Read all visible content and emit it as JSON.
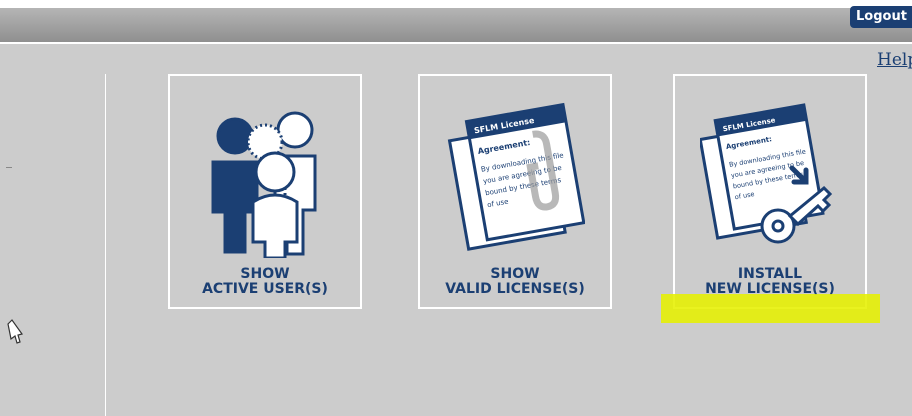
{
  "header": {
    "logout_label": "Logout"
  },
  "help_link": "Help",
  "tiles": [
    {
      "line1": "SHOW",
      "line2": "ACTIVE USER(S)",
      "icon": "users-icon"
    },
    {
      "line1": "SHOW",
      "line2": "VALID LICENSE(S)",
      "icon": "license-document-icon"
    },
    {
      "line1": "INSTALL",
      "line2": "NEW LICENSE(S)",
      "icon": "install-license-icon"
    }
  ],
  "license_doc": {
    "title": "SFLM License",
    "heading": "Agreement:",
    "body": [
      "By downloading this file",
      "you are agreeing to be",
      "bound by these terms",
      "of use"
    ]
  },
  "colors": {
    "accent": "#1b3f73",
    "background": "#cccccc",
    "highlight": "#e6f000"
  }
}
